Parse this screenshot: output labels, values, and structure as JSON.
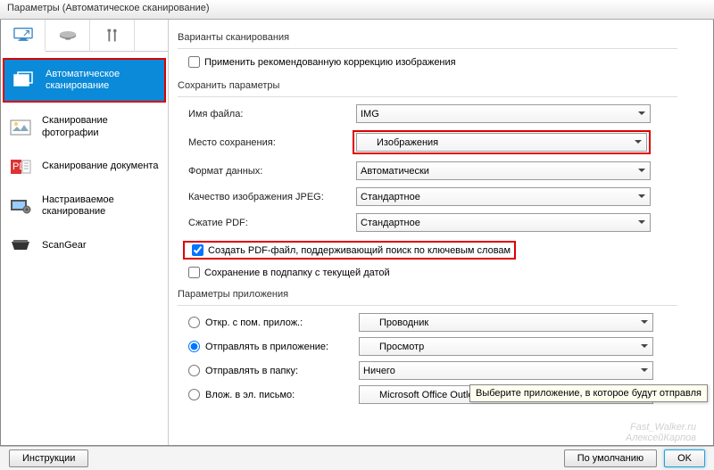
{
  "window": {
    "title": "Параметры (Автоматическое сканирование)"
  },
  "sidebar": {
    "items": [
      {
        "label": "Автоматическое сканирование"
      },
      {
        "label": "Сканирование фотографии"
      },
      {
        "label": "Сканирование документа"
      },
      {
        "label": "Настраиваемое сканирование"
      },
      {
        "label": "ScanGear"
      }
    ]
  },
  "sections": {
    "scan_opts": {
      "title": "Варианты сканирования",
      "apply_correction": "Применить рекомендованную коррекцию изображения"
    },
    "save": {
      "title": "Сохранить параметры",
      "filename_label": "Имя файла:",
      "filename_value": "IMG",
      "location_label": "Место сохранения:",
      "location_value": "Изображения",
      "format_label": "Формат данных:",
      "format_value": "Автоматически",
      "jpeg_label": "Качество изображения JPEG:",
      "jpeg_value": "Стандартное",
      "pdf_label": "Сжатие PDF:",
      "pdf_value": "Стандартное",
      "pdf_search": "Создать PDF-файл, поддерживающий поиск по ключевым словам",
      "subfolder": "Сохранение в подпапку с текущей датой"
    },
    "app": {
      "title": "Параметры приложения",
      "open_with": "Откр. с пом. прилож.:",
      "open_with_value": "Проводник",
      "send_app": "Отправлять в приложение:",
      "send_app_value": "Просмотр",
      "send_folder": "Отправлять в папку:",
      "send_folder_value": "Ничего",
      "send_email": "Влож. в эл. письмо:",
      "send_email_value": "Microsoft Office Outlook"
    }
  },
  "tooltip": "Выберите приложение, в которое будут отправля",
  "footer": {
    "instructions": "Инструкции",
    "defaults": "По умолчанию",
    "ok": "OK"
  },
  "watermark": {
    "l1": "Fast_Walker.ru",
    "l2": "АлексейКарпов"
  }
}
